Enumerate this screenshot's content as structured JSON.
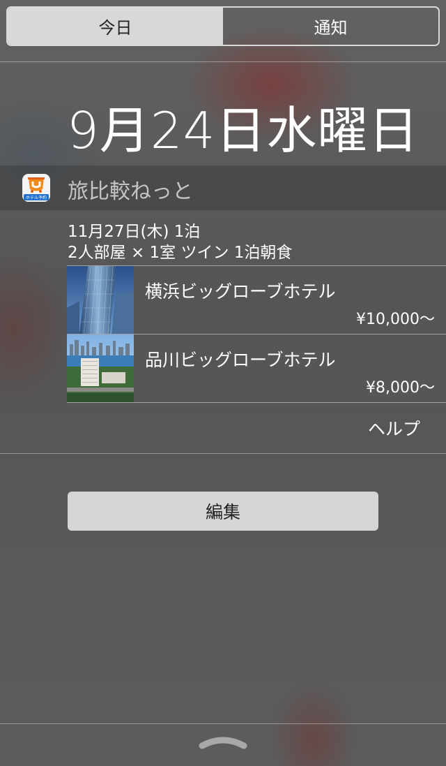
{
  "segment": {
    "today_label": "今日",
    "notifications_label": "通知"
  },
  "date_heading": "9月24日水曜日",
  "widget": {
    "app_name": "旅比較ねっと",
    "icon_caption": "ホテル予約",
    "summary_line1": "11月27日(木)  1泊",
    "summary_line2": "2人部屋 × 1室  ツイン  1泊朝食",
    "hotels": [
      {
        "name": "横浜ビッグローブホテル",
        "price": "¥10,000〜"
      },
      {
        "name": "品川ビッグローブホテル",
        "price": "¥8,000〜"
      }
    ],
    "help_label": "ヘルプ"
  },
  "edit_button_label": "編集",
  "colors": {
    "segment_active": "#d8d8d8",
    "button_bg": "#d6d6d6",
    "app_icon_orange": "#f08a1c",
    "app_icon_blue": "#1e6fd0"
  },
  "icons": {
    "app": "hotel-app-icon",
    "grabber": "pull-up-grabber-icon"
  }
}
